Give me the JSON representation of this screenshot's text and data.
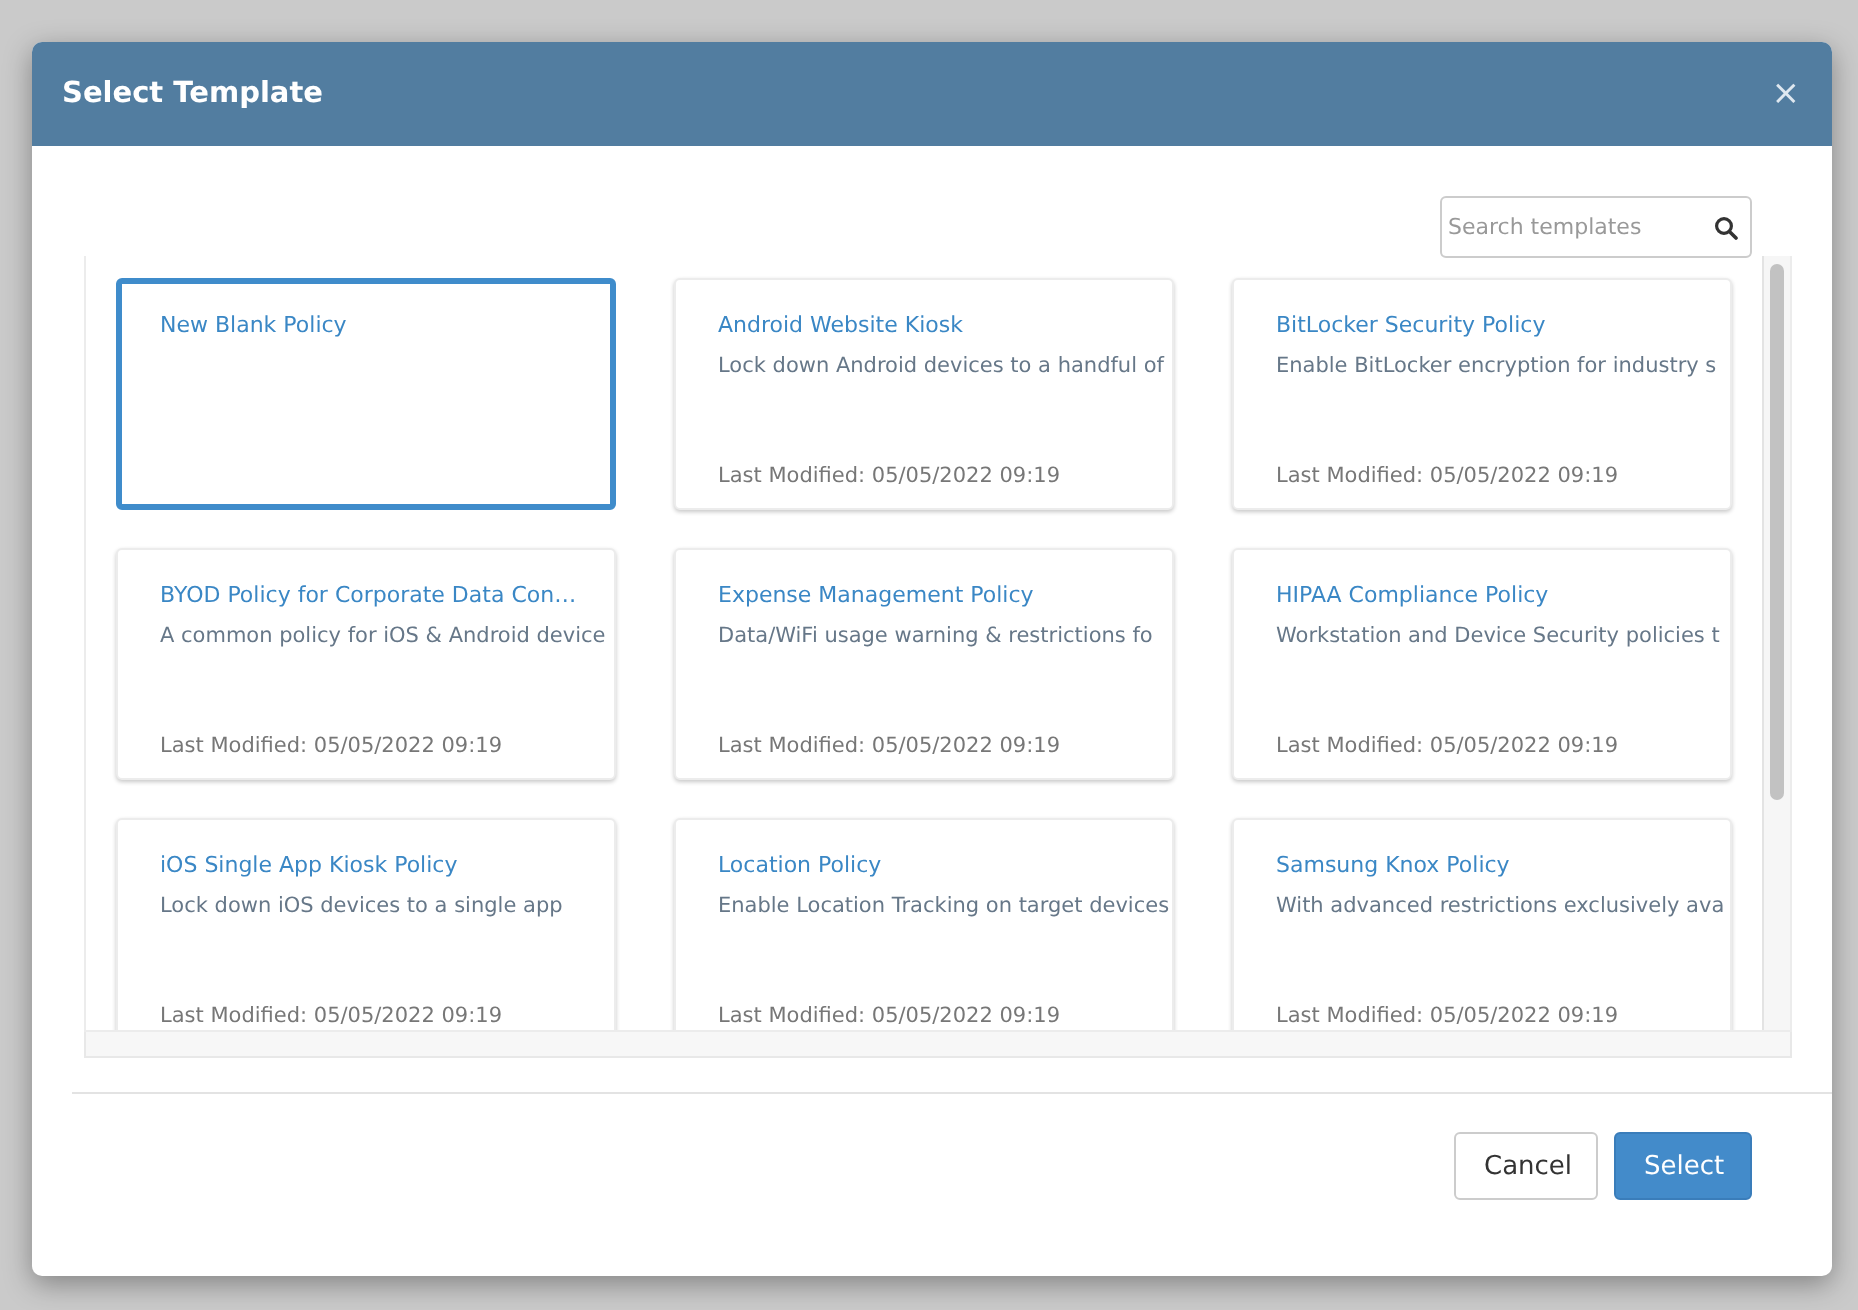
{
  "dialog": {
    "title": "Select Template",
    "close": "×"
  },
  "search": {
    "placeholder": "Search templates"
  },
  "templates": [
    {
      "name": "New Blank Policy",
      "selected": true
    },
    {
      "name": "Android Website Kiosk",
      "description": "Lock down Android devices to a handful of",
      "modified": "Last Modified: 05/05/2022 09:19",
      "selected": false
    },
    {
      "name": "BitLocker Security Policy",
      "description": "Enable BitLocker encryption for industry s",
      "modified": "Last Modified: 05/05/2022 09:19",
      "selected": false
    },
    {
      "name": "BYOD Policy for Corporate Data Con…",
      "description": "A common policy for iOS & Android device",
      "modified": "Last Modified: 05/05/2022 09:19",
      "selected": false
    },
    {
      "name": "Expense Management Policy",
      "description": "Data/WiFi usage warning & restrictions fo",
      "modified": "Last Modified: 05/05/2022 09:19",
      "selected": false
    },
    {
      "name": "HIPAA Compliance Policy",
      "description": "Workstation and Device Security policies t",
      "modified": "Last Modified: 05/05/2022 09:19",
      "selected": false
    },
    {
      "name": "iOS Single App Kiosk Policy",
      "description": "Lock down iOS devices to a single app",
      "modified": "Last Modified: 05/05/2022 09:19",
      "selected": false
    },
    {
      "name": "Location Policy",
      "description": "Enable Location Tracking on target devices",
      "modified": "Last Modified: 05/05/2022 09:19",
      "selected": false
    },
    {
      "name": "Samsung Knox Policy",
      "description": "With advanced restrictions exclusively ava",
      "modified": "Last Modified: 05/05/2022 09:19",
      "selected": false
    }
  ],
  "buttons": [
    {
      "label": "Cancel",
      "kind": "secondary"
    },
    {
      "label": "Select",
      "kind": "primary"
    }
  ]
}
